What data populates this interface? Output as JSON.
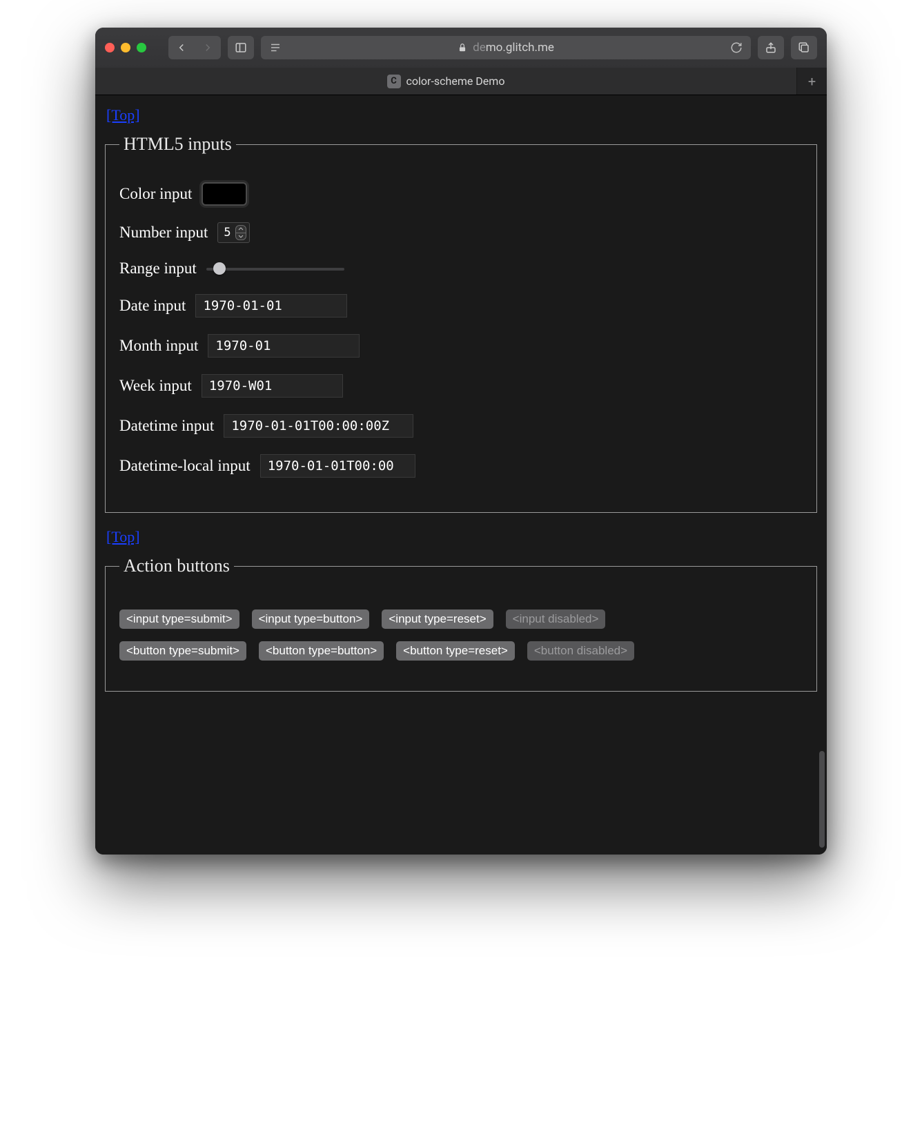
{
  "browser": {
    "url_dim_prefix": "de",
    "url_host": "mo.glitch.me",
    "tab_title": "color-scheme Demo",
    "favicon_letter": "C"
  },
  "top_link_text": "[Top]",
  "fieldset1": {
    "legend": "HTML5 inputs",
    "color_label": "Color input",
    "number_label": "Number input",
    "number_value": "5",
    "range_label": "Range input",
    "date_label": "Date input",
    "date_value": "1970-01-01",
    "month_label": "Month input",
    "month_value": "1970-01",
    "week_label": "Week input",
    "week_value": "1970-W01",
    "datetime_label": "Datetime input",
    "datetime_value": "1970-01-01T00:00:00Z",
    "datetime_local_label": "Datetime-local input",
    "datetime_local_value": "1970-01-01T00:00"
  },
  "fieldset2": {
    "legend": "Action buttons",
    "input_submit": "<input type=submit>",
    "input_button": "<input type=button>",
    "input_reset": "<input type=reset>",
    "input_disabled": "<input disabled>",
    "button_submit": "<button type=submit>",
    "button_button": "<button type=button>",
    "button_reset": "<button type=reset>",
    "button_disabled": "<button disabled>"
  }
}
